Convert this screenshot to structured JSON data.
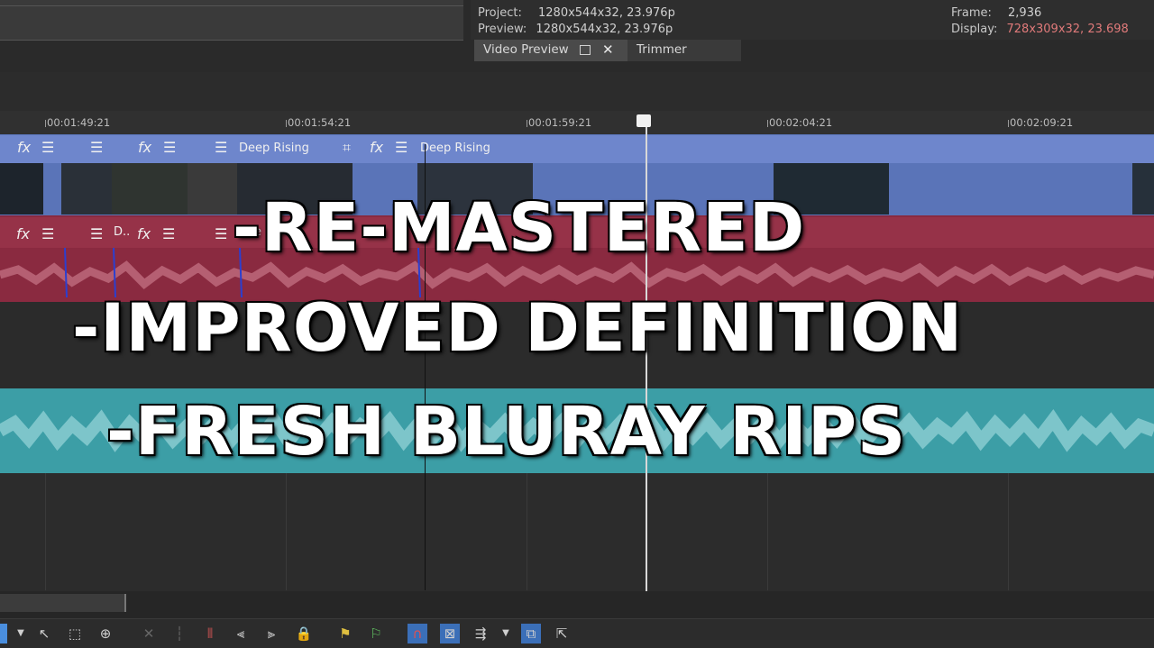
{
  "info": {
    "project_label": "Project:",
    "project_value": "1280x544x32, 23.976p",
    "preview_label": "Preview:",
    "preview_value": "1280x544x32, 23.976p",
    "frame_label": "Frame:",
    "frame_value": "2,936",
    "display_label": "Display:",
    "display_value": "728x309x32, 23.698"
  },
  "tabs": {
    "video_preview": "Video Preview",
    "trimmer": "Trimmer"
  },
  "ruler": {
    "labels": [
      "00:01:49:21",
      "00:01:54:21",
      "00:01:59:21",
      "00:02:04:21",
      "00:02:09:21"
    ]
  },
  "video_track": {
    "clip1_name": "Deep Rising",
    "clip2_name": "Deep Rising"
  },
  "audio_track": {
    "clip1_name": "D..",
    "clip2_name": "Dee"
  },
  "overlay": {
    "line1": "-RE-MASTERED",
    "line2": "-IMPROVED DEFINITION",
    "line3": "-FRESH BLURAY RIPS"
  },
  "icons": [
    "fx-icon",
    "menu-icon",
    "crop-icon",
    "cursor-icon",
    "magnet-icon"
  ],
  "colors": {
    "video_track": "#6e86cc",
    "audio_track": "#8a2a40",
    "music_track": "#3c9ea6",
    "warning_text": "#e07a7a"
  }
}
